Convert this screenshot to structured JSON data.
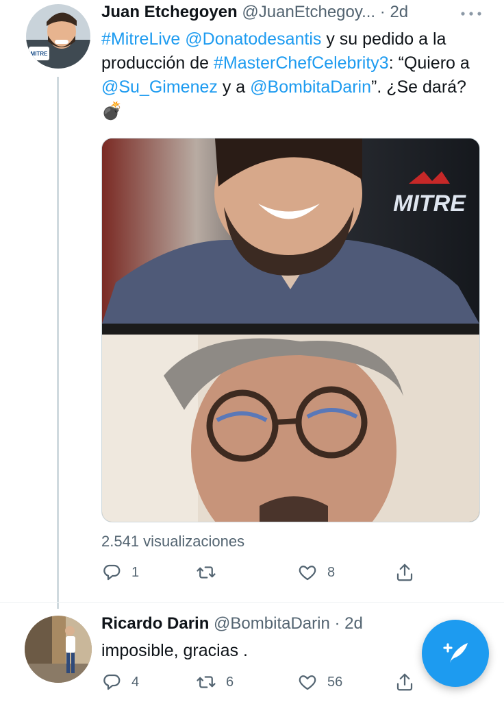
{
  "tweet1": {
    "author_name": "Juan Etchegoyen",
    "author_handle": "@JuanEtchegoy...",
    "separator": "·",
    "time": "2d",
    "text_parts": [
      "#MitreLive",
      " ",
      "@Donatodesantis",
      " y su pedido a la producción de ",
      "#MasterChefCelebrity3",
      ": “Quiero a ",
      "@Su_Gimenez",
      " y a ",
      "@BombitaDarin",
      "”. ¿Se dará? ",
      "💣"
    ],
    "media_logo": "MITRE",
    "views_text": "2.541 visualizaciones",
    "actions": {
      "replies": "1",
      "retweets": "",
      "likes": "8"
    }
  },
  "tweet2": {
    "author_name": "Ricardo Darin",
    "author_handle": "@BombitaDarin",
    "separator": "·",
    "time": "2d",
    "text": "imposible, gracias .",
    "actions": {
      "replies": "4",
      "retweets": "6",
      "likes": "56"
    }
  },
  "avatar1_badge": "MITRE",
  "colors": {
    "link": "#1d9bf0",
    "muted": "#536471",
    "text": "#0f1419",
    "fab": "#1d9bf0"
  },
  "icons": [
    "more-icon",
    "reply-icon",
    "retweet-icon",
    "like-icon",
    "share-icon",
    "compose-icon"
  ]
}
